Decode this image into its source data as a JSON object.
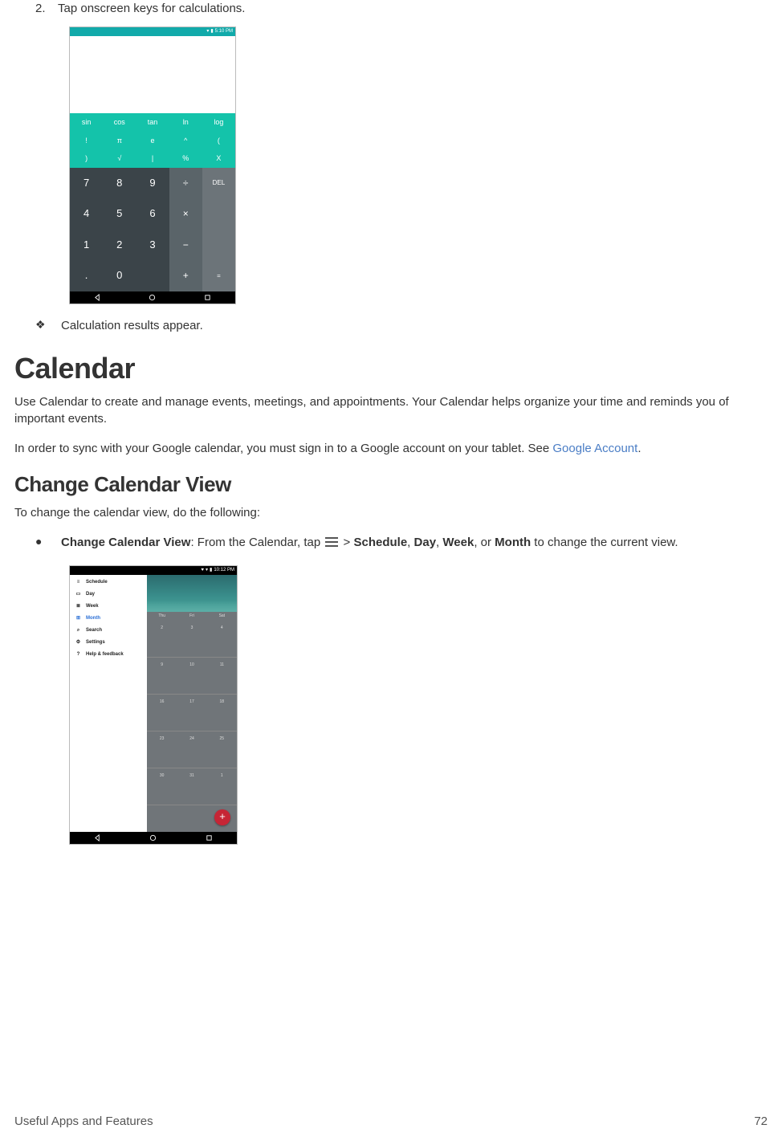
{
  "step2": {
    "num": "2.",
    "text": "Tap onscreen keys for calculations."
  },
  "calc": {
    "status_time": "5:10 PM",
    "func_rows": [
      [
        "sin",
        "cos",
        "tan",
        "ln",
        "log"
      ],
      [
        "!",
        "π",
        "e",
        "^",
        "(",
        ""
      ],
      [
        ")",
        "√",
        "|",
        "%",
        "X",
        ""
      ]
    ],
    "num_keys": [
      "7",
      "8",
      "9",
      "4",
      "5",
      "6",
      "1",
      "2",
      "3",
      ".",
      "0",
      ""
    ],
    "op_keys": [
      "÷",
      "×",
      "−",
      "+"
    ],
    "del_keys": [
      "DEL",
      "",
      "",
      "="
    ]
  },
  "result_bullet": "Calculation results appear.",
  "calendar_h1": "Calendar",
  "calendar_p1": "Use Calendar to create and manage events, meetings, and appointments. Your Calendar helps organize your time and reminds you of important events.",
  "calendar_p2a": "In order to sync with your Google calendar, you must sign in to a Google account on your tablet. See ",
  "calendar_p2_link": "Google Account",
  "calendar_p2b": ".",
  "change_view_h2": "Change Calendar View",
  "change_view_p": "To change the calendar view, do the following:",
  "bullet_label": "Change Calendar View",
  "bullet_text1": ": From the Calendar, tap ",
  "bullet_text2": " > ",
  "bullet_opts": [
    "Schedule",
    "Day",
    "Week",
    "Month"
  ],
  "bullet_text3": " to change the current view.",
  "cal_shot": {
    "status_time": "10:12 PM",
    "sidebar": [
      {
        "label": "Schedule",
        "icon": "list"
      },
      {
        "label": "Day",
        "icon": "day"
      },
      {
        "label": "Week",
        "icon": "week"
      },
      {
        "label": "Month",
        "icon": "month",
        "active": true
      },
      {
        "label": "Search",
        "icon": "search"
      },
      {
        "label": "Settings",
        "icon": "gear"
      },
      {
        "label": "Help & feedback",
        "icon": "help"
      }
    ],
    "day_headers": [
      "Thu",
      "Fri",
      "Sat"
    ],
    "weeks": [
      [
        "2",
        "3",
        "4"
      ],
      [
        "9",
        "10",
        "11"
      ],
      [
        "16",
        "17",
        "18"
      ],
      [
        "23",
        "24",
        "25"
      ],
      [
        "30",
        "31",
        "1"
      ]
    ]
  },
  "footer_left": "Useful Apps and Features",
  "footer_right": "72"
}
